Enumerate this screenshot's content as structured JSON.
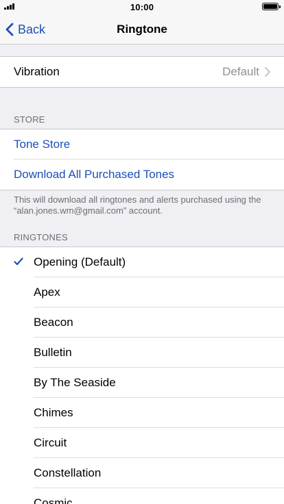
{
  "status_bar": {
    "time": "10:00"
  },
  "nav": {
    "back_label": "Back",
    "title": "Ringtone"
  },
  "vibration": {
    "label": "Vibration",
    "value": "Default"
  },
  "store": {
    "header": "STORE",
    "tone_store": "Tone Store",
    "download_all": "Download All Purchased Tones",
    "note": "This will download all ringtones and alerts purchased using the “alan.jones.wm@gmail.com” account."
  },
  "ringtones": {
    "header": "RINGTONES",
    "selected": "Opening (Default)",
    "items": [
      "Opening (Default)",
      "Apex",
      "Beacon",
      "Bulletin",
      "By The Seaside",
      "Chimes",
      "Circuit",
      "Constellation",
      "Cosmic"
    ]
  },
  "colors": {
    "accent": "#1c4fb8",
    "background": "#efeff4",
    "secondary_text": "#8e8e93"
  }
}
